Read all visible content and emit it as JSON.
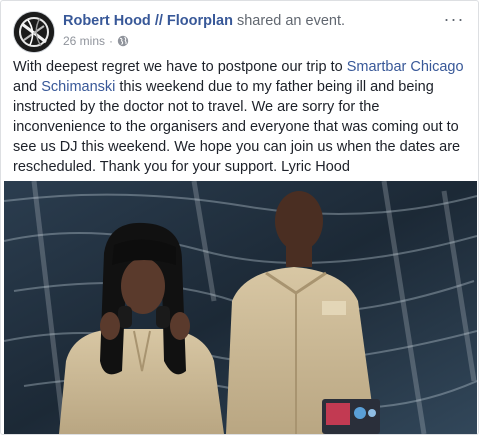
{
  "post": {
    "author": "Robert Hood // Floorplan",
    "action": " shared an event.",
    "timestamp": "26 mins",
    "separator": "·",
    "privacy_icon": "globe-icon",
    "more_icon": "more-options-icon",
    "more_label": "···",
    "text": {
      "part1": "With deepest regret we have to postpone our trip to ",
      "link1": "Smartbar Chicago",
      "part2": " and ",
      "link2": "Schimanski",
      "part3": " this weekend due to my father being ill and being instructed by the doctor not to travel. We are sorry for the inconvenience to the organisers and everyone that was coming out to see us DJ this weekend. We hope you can join us when the dates are rescheduled. Thank you for your support. Lyric Hood"
    }
  },
  "colors": {
    "link": "#385898",
    "text": "#1d2129",
    "meta": "#90949c",
    "border": "#dddfe2"
  }
}
